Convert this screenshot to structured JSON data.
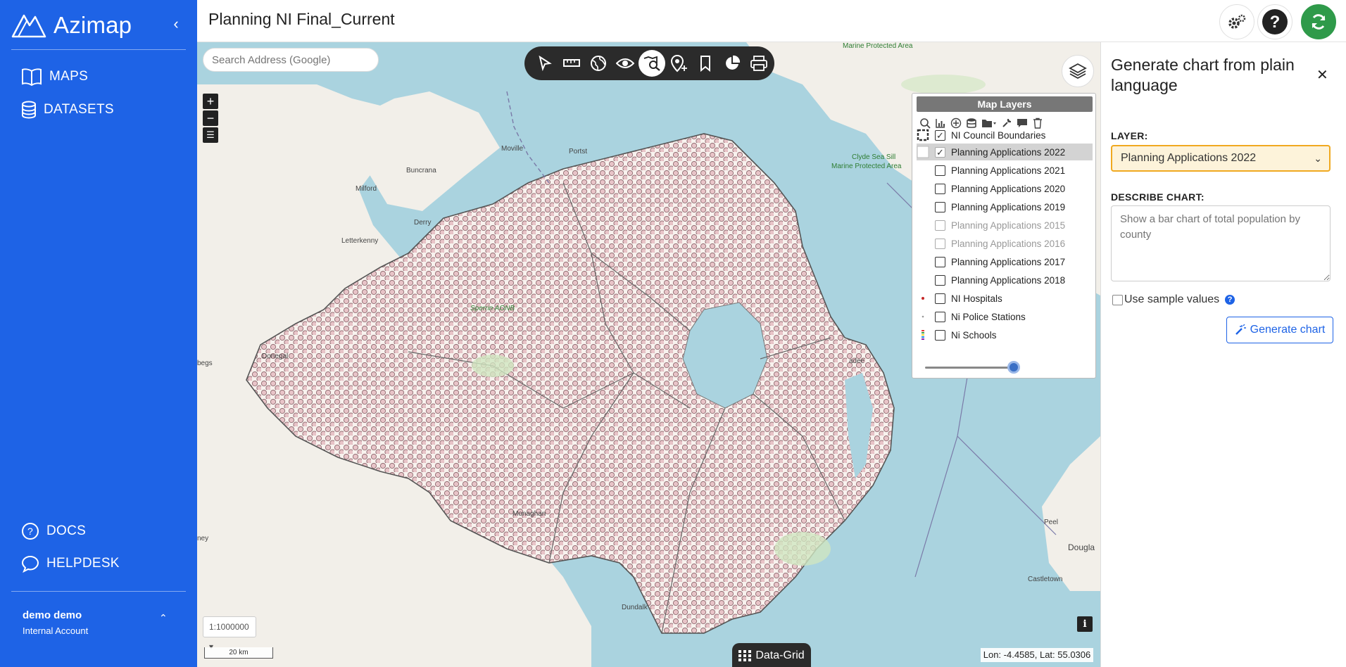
{
  "app": {
    "brand": "Azimap",
    "collapse_icon": "chevron-left-icon"
  },
  "sidebar": {
    "nav": [
      {
        "label": "MAPS",
        "icon": "book-open-icon"
      },
      {
        "label": "DATASETS",
        "icon": "database-icon"
      }
    ],
    "bottom_nav": [
      {
        "label": "DOCS",
        "icon": "question-circle-icon"
      },
      {
        "label": "HELPDESK",
        "icon": "chat-icon"
      }
    ],
    "user": {
      "name": "demo demo",
      "role": "Internal Account"
    }
  },
  "header": {
    "title": "Planning NI Final_Current",
    "buttons": [
      "settings-icon",
      "help-icon",
      "refresh-icon"
    ]
  },
  "map": {
    "search_placeholder": "Search Address (Google)",
    "zoom_in": "+",
    "zoom_out": "−",
    "tools": [
      "select-tool-icon",
      "measure-tool-icon",
      "globe-tool-icon",
      "view-tool-icon",
      "search-map-tool-icon",
      "location-tool-icon",
      "bookmark-tool-icon",
      "pie-chart-tool-icon",
      "print-tool-icon"
    ],
    "active_tool": 4,
    "layers_panel": {
      "title": "Map Layers",
      "layers": [
        {
          "name": "NI Council Boundaries",
          "checked": true,
          "dim": false,
          "selected": false
        },
        {
          "name": "Planning Applications 2022",
          "checked": true,
          "dim": false,
          "selected": true
        },
        {
          "name": "Planning Applications 2021",
          "checked": false,
          "dim": false,
          "selected": false
        },
        {
          "name": "Planning Applications 2020",
          "checked": false,
          "dim": false,
          "selected": false
        },
        {
          "name": "Planning Applications 2019",
          "checked": false,
          "dim": false,
          "selected": false
        },
        {
          "name": "Planning Applications 2015",
          "checked": false,
          "dim": true,
          "selected": false
        },
        {
          "name": "Planning Applications 2016",
          "checked": false,
          "dim": true,
          "selected": false
        },
        {
          "name": "Planning Applications 2017",
          "checked": false,
          "dim": false,
          "selected": false
        },
        {
          "name": "Planning Applications 2018",
          "checked": false,
          "dim": false,
          "selected": false
        },
        {
          "name": "NI Hospitals",
          "checked": false,
          "dim": false,
          "selected": false
        },
        {
          "name": "Ni Police Stations",
          "checked": false,
          "dim": false,
          "selected": false
        },
        {
          "name": "Ni Schools",
          "checked": false,
          "dim": false,
          "selected": false
        }
      ],
      "opacity": 0.9
    },
    "place_labels": [
      "Marine Protected Area",
      "Clyde Sea Sill",
      "Marine Protected Area",
      "Moville",
      "Portst",
      "Buncrana",
      "Milford",
      "Derry",
      "Letterkenny",
      "Sperrin AONB",
      "Donegal",
      "begs",
      "Monaghan",
      "Dundalk",
      "adee",
      "Peel",
      "Dougla",
      "Castletown",
      "ney"
    ],
    "scale": "1:1000000",
    "scale_bar": "20 km",
    "datagrid_label": "Data-Grid",
    "coordinates": "Lon: -4.4585, Lat: 55.0306"
  },
  "chart_panel": {
    "title": "Generate chart from plain language",
    "layer_label": "LAYER:",
    "layer_value": "Planning Applications 2022",
    "describe_label": "DESCRIBE CHART:",
    "describe_placeholder": "Show a bar chart of total population by county",
    "sample_label": "Use sample values",
    "generate_label": "Generate chart"
  }
}
